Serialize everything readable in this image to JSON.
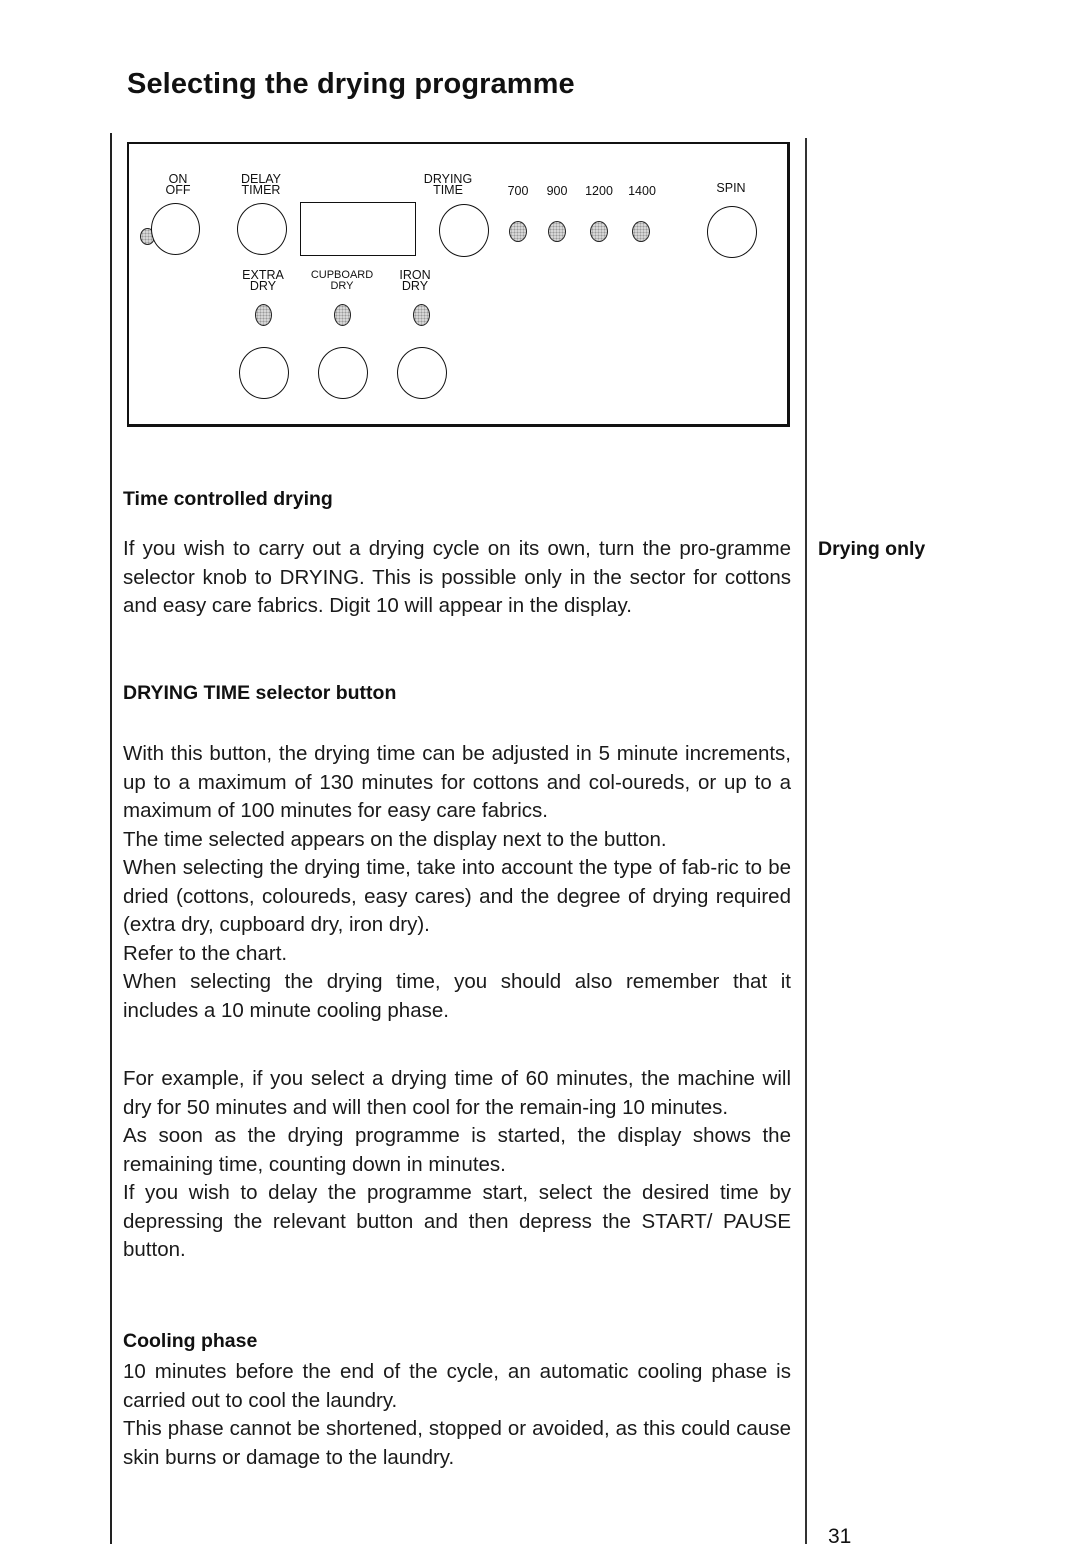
{
  "page": {
    "title": "Selecting the drying programme",
    "page_number": "31",
    "side_heading": "Drying only"
  },
  "control_panel": {
    "labels": {
      "on_off": "ON\nOFF",
      "delay_timer": "DELAY\nTIMER",
      "drying_time": "DRYING\nTIME",
      "spin": "SPIN",
      "extra_dry": "EXTRA\nDRY",
      "cupboard_dry": "CUPBOARD\nDRY",
      "iron_dry": "IRON\nDRY"
    },
    "spin_speeds": [
      "700",
      "900",
      "1200",
      "1400"
    ]
  },
  "sections": {
    "time_controlled": {
      "heading": "Time controlled drying",
      "paragraphs": [
        "If you wish to carry out a drying cycle on its own, turn the pro-gramme selector knob to DRYING. This is possible only in the sector for cottons and easy care fabrics. Digit 10 will appear in the display."
      ]
    },
    "drying_time_button": {
      "heading": "DRYING TIME selector button",
      "paragraphs": [
        "With this button, the drying time can be adjusted in 5 minute increments, up to a maximum of 130 minutes for cottons and col-oureds, or up to a maximum of 100 minutes for easy care fabrics.",
        "The time selected appears on the display next to the button.",
        "When selecting the drying time, take into account the type of fab-ric to be dried (cottons, coloureds, easy cares) and the degree of drying required (extra dry, cupboard dry, iron dry).",
        "Refer to the chart.",
        "When selecting the drying time, you should also remember that it includes a 10 minute cooling phase."
      ],
      "example_paragraphs": [
        "For example, if you select a drying time of 60 minutes, the machine will dry for 50 minutes and will then cool for the remain-ing 10 minutes.",
        "As soon as the drying programme is started, the display shows the remaining time, counting down in minutes.",
        "If you wish to delay the programme start, select the desired time by depressing the relevant button and then depress the START/ PAUSE button."
      ]
    },
    "cooling_phase": {
      "heading": "Cooling phase",
      "paragraphs": [
        "10 minutes before the end of the cycle, an automatic cooling phase is carried out to cool the laundry.",
        "This phase cannot be shortened, stopped or avoided, as this could cause skin burns or damage to the laundry."
      ]
    }
  }
}
